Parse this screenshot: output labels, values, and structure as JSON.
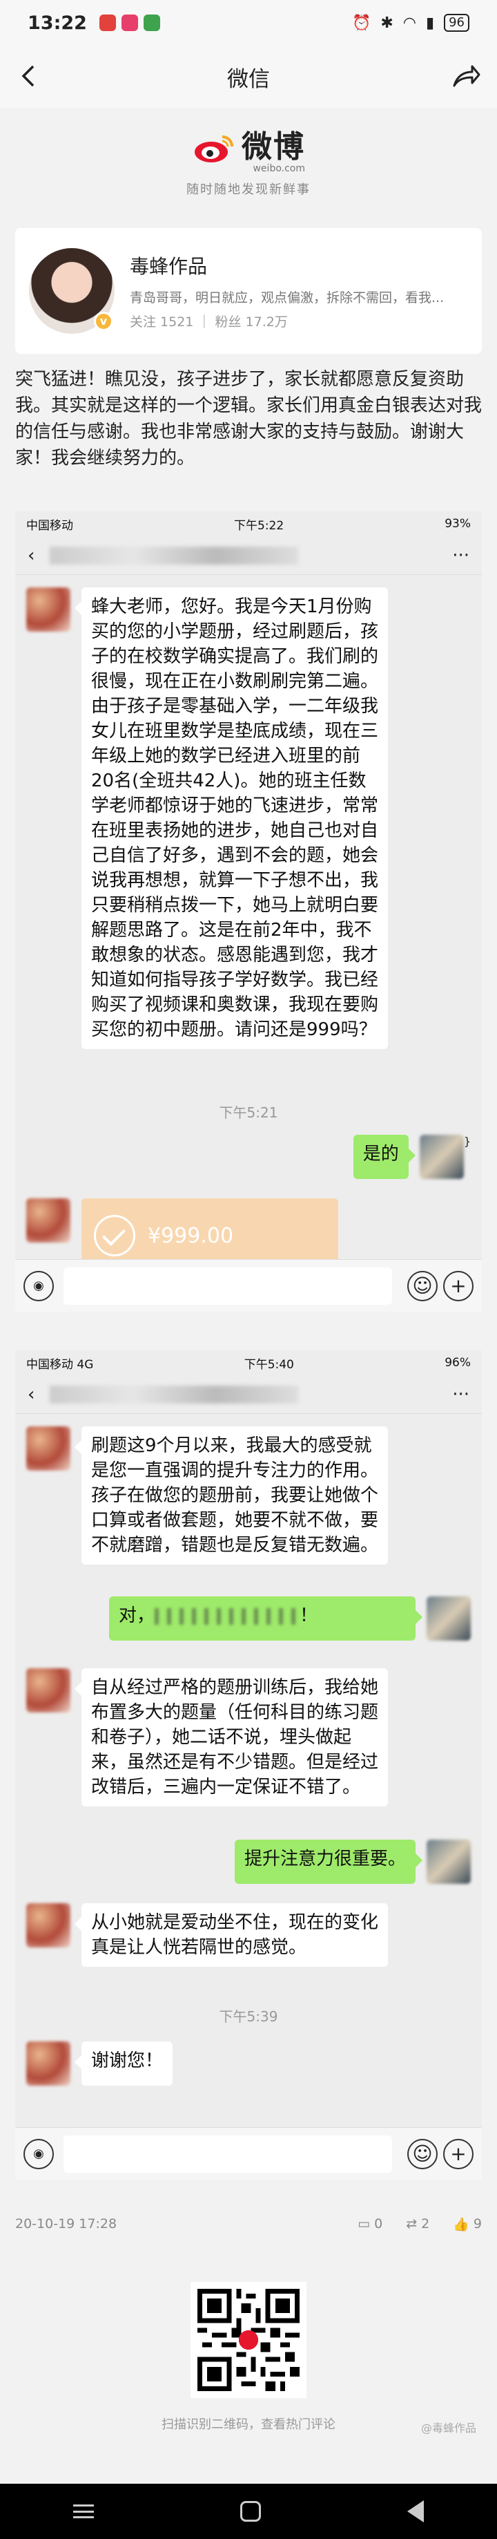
{
  "status": {
    "time": "13:22",
    "battery": "96"
  },
  "nav": {
    "title": "微信"
  },
  "weibo": {
    "name": "微博",
    "domain": "weibo.com",
    "slogan": "随时随地发现新鲜事"
  },
  "profile": {
    "name": "毒蜂作品",
    "desc": "青岛哥哥，明日就应，观点偏激，拆除不需回，看我...",
    "stats": "关注 1521 ｜ 粉丝 17.2万"
  },
  "post": {
    "text": "突飞猛进！瞧见没，孩子进步了，家长就都愿意反复资助我。其实就是这样的一个逻辑。家长们用真金白银表达对我的信任与感谢。我也非常感谢大家的支持与鼓励。谢谢大家！我会继续努力的。"
  },
  "chat1": {
    "status_left": "中国移动",
    "status_time": "下午5:22",
    "status_right": "93%",
    "msg1": "蜂大老师，您好。我是今天1月份购买的您的小学题册，经过刷题后，孩子的在校数学确实提高了。我们刷的很慢，现在正在小数刷刷完第二遍。由于孩子是零基础入学，一二年级我女儿在班里数学是垫底成绩，现在三年级上她的数学已经进入班里的前20名(全班共42人)。她的班主任数学老师都惊讶于她的飞速进步，常常在班里表扬她的进步，她自己也对自己自信了好多，遇到不会的题，她会说我再想想，就算一下子想不出，我只要稍稍点拨一下，她马上就明白要解题思路了。这是在前2年中，我不敢想象的状态。感恩能遇到您，我才知道如何指导孩子学好数学。我已经购买了视频课和奥数课，我现在要购买您的初中题册。请问还是999吗？",
    "time2": "下午5:21",
    "reply1": "是的",
    "transfer": "¥999.00"
  },
  "chat2": {
    "status_left": "中国移动 4G",
    "status_time": "下午5:40",
    "status_right": "96%",
    "msg1": "刷题这9个月以来，我最大的感受就是您一直强调的提升专注力的作用。孩子在做您的题册前，我要让她做个口算或者做套题，她要不就不做，要不就磨蹭，错题也是反复错无数遍。",
    "reply1a": "对，",
    "reply1b": "！",
    "msg2": "自从经过严格的题册训练后，我给她布置多大的题量（任何科目的练习题和卷子），她二话不说，埋头做起来，虽然还是有不少错题。但是经过改错后，三遍内一定保证不错了。",
    "reply2": "提升注意力很重要。",
    "msg3": "从小她就是爱动坐不住，现在的变化真是让人恍若隔世的感觉。",
    "time": "下午5:39",
    "msg4": "谢谢您！"
  },
  "footer": {
    "date": "20-10-19 17:28",
    "comments": "0",
    "reposts": "2",
    "likes": "9",
    "qr_caption": "扫描识别二维码，查看热门评论",
    "watermark": "@毒蜂作品"
  }
}
